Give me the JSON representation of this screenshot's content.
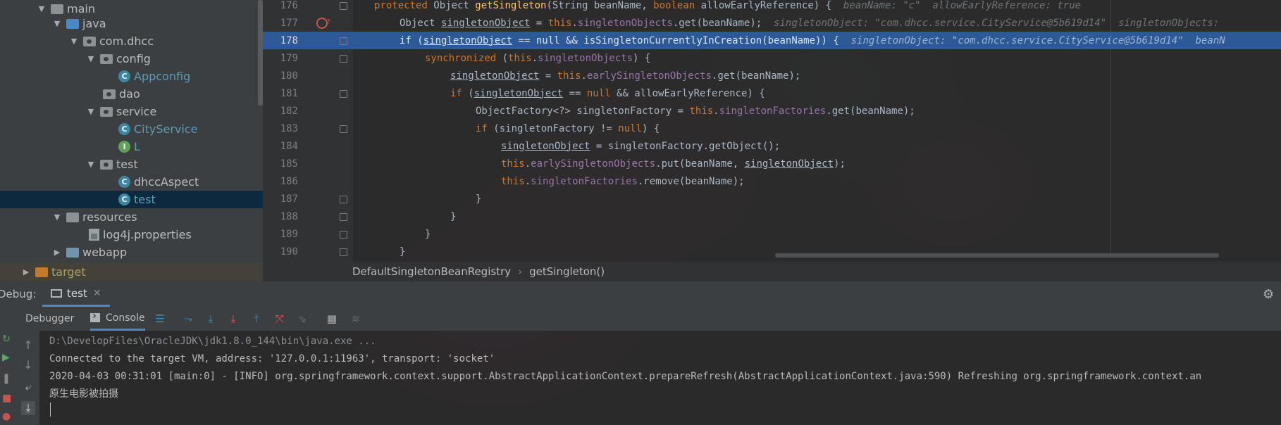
{
  "project_tree": {
    "items": [
      {
        "label": "main",
        "arrow": "▼",
        "icon": "folder"
      },
      {
        "label": "java",
        "arrow": "▼",
        "icon": "source-folder"
      },
      {
        "label": "com.dhcc",
        "arrow": "▼",
        "icon": "package"
      },
      {
        "label": "config",
        "arrow": "▼",
        "icon": "package"
      },
      {
        "label": "Appconfig",
        "arrow": "",
        "icon": "class",
        "icon_letter": "C"
      },
      {
        "label": "dao",
        "arrow": "",
        "icon": "package"
      },
      {
        "label": "service",
        "arrow": "▼",
        "icon": "package"
      },
      {
        "label": "CityService",
        "arrow": "",
        "icon": "class",
        "icon_letter": "C"
      },
      {
        "label": "L",
        "arrow": "",
        "icon": "interface",
        "icon_letter": "I"
      },
      {
        "label": "test",
        "arrow": "▼",
        "icon": "package"
      },
      {
        "label": "dhccAspect",
        "arrow": "",
        "icon": "class",
        "icon_letter": "C"
      },
      {
        "label": "test",
        "arrow": "",
        "icon": "class",
        "icon_letter": "C",
        "selected": true
      },
      {
        "label": "resources",
        "arrow": "▼",
        "icon": "resources-folder"
      },
      {
        "label": "log4j.properties",
        "arrow": "",
        "icon": "properties-file"
      },
      {
        "label": "webapp",
        "arrow": "▶",
        "icon": "web-folder"
      },
      {
        "label": "target",
        "arrow": "▶",
        "icon": "excluded-folder"
      }
    ]
  },
  "editor": {
    "lines": [
      {
        "num": "176"
      },
      {
        "num": "177"
      },
      {
        "num": "178"
      },
      {
        "num": "179"
      },
      {
        "num": "180"
      },
      {
        "num": "181"
      },
      {
        "num": "182"
      },
      {
        "num": "183"
      },
      {
        "num": "184"
      },
      {
        "num": "185"
      },
      {
        "num": "186"
      },
      {
        "num": "187"
      },
      {
        "num": "188"
      },
      {
        "num": "189"
      },
      {
        "num": "190"
      }
    ],
    "code": {
      "l176_kw1": "protected",
      "l176_t1": " Object ",
      "l176_m": "getSingleton",
      "l176_t2": "(String beanName, ",
      "l176_kw2": "boolean",
      "l176_t3": " allowEarlyReference) {  ",
      "l176_hint": "beanName: \"c\"  allowEarlyReference: true",
      "l177_t1": "Object ",
      "l177_v": "singletonObject",
      "l177_t2": " = ",
      "l177_kw": "this",
      "l177_t3": ".",
      "l177_f": "singletonObjects",
      "l177_t4": ".get(beanName);  ",
      "l177_hint": "singletonObject: \"com.dhcc.service.CityService@5b619d14\"  singletonObjects: ",
      "l178_kw1": "if",
      "l178_t1": " (",
      "l178_v": "singletonObject",
      "l178_t2": " == ",
      "l178_kw2": "null",
      "l178_t3": " && isSingletonCurrentlyInCreation(beanName)) {  ",
      "l178_hint": "singletonObject: \"com.dhcc.service.CityService@5b619d14\"  beanN",
      "l179_kw": "synchronized",
      "l179_t1": " (",
      "l179_kw2": "this",
      "l179_t2": ".",
      "l179_f": "singletonObjects",
      "l179_t3": ") {",
      "l180_v": "singletonObject",
      "l180_t1": " = ",
      "l180_kw": "this",
      "l180_t2": ".",
      "l180_f": "earlySingletonObjects",
      "l180_t3": ".get(beanName);",
      "l181_kw1": "if",
      "l181_t1": " (",
      "l181_v": "singletonObject",
      "l181_t2": " == ",
      "l181_kw2": "null",
      "l181_t3": " && allowEarlyReference) {",
      "l182_t1": "ObjectFactory<?> singletonFactory = ",
      "l182_kw": "this",
      "l182_t2": ".",
      "l182_f": "singletonFactories",
      "l182_t3": ".get(beanName);",
      "l183_kw1": "if",
      "l183_t1": " (singletonFactory != ",
      "l183_kw2": "null",
      "l183_t2": ") {",
      "l184_v": "singletonObject",
      "l184_t1": " = singletonFactory.getObject();",
      "l185_kw": "this",
      "l185_t1": ".",
      "l185_f": "earlySingletonObjects",
      "l185_t2": ".put(beanName, ",
      "l185_v": "singletonObject",
      "l185_t3": ");",
      "l186_kw": "this",
      "l186_t1": ".",
      "l186_f": "singletonFactories",
      "l186_t2": ".remove(beanName);",
      "l187": "}",
      "l188": "}",
      "l189": "}",
      "l190": "}"
    },
    "breadcrumb": {
      "class": "DefaultSingletonBeanRegistry",
      "method": "getSingleton()"
    }
  },
  "debug": {
    "label": "Debug:",
    "session_tab": "test",
    "tabs": {
      "debugger": "Debugger",
      "console": "Console"
    },
    "console_lines": [
      "D:\\DevelopFiles\\OracleJDK\\jdk1.8.0_144\\bin\\java.exe ...",
      "Connected to the target VM, address: '127.0.0.1:11963', transport: 'socket'",
      "2020-04-03 00:31:01 [main:0] - [INFO] org.springframework.context.support.AbstractApplicationContext.prepareRefresh(AbstractApplicationContext.java:590) Refreshing org.springframework.context.an",
      "原生电影被拍摄"
    ]
  },
  "colors": {
    "keyword": "#cc7832",
    "field": "#9876aa",
    "method": "#ffc66d",
    "execution_line": "#2d5996",
    "selection": "#0d293e"
  }
}
